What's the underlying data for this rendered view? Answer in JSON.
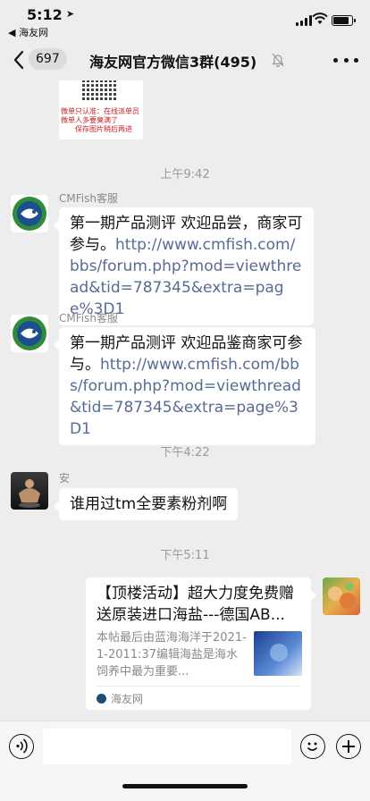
{
  "status_bar": {
    "time": "5:12",
    "back_app": "◀ 海友网",
    "battery_level": 0.9
  },
  "nav": {
    "unread_count": "697",
    "title": "海友网官方微信3群(495)"
  },
  "messages": {
    "image_caption_1": "微单只认准：在线派单员",
    "image_caption_2": "微单人多要臭满了",
    "image_caption_3": "保存图片稍后再进",
    "time_1": "上午9:42",
    "msg1": {
      "sender": "CMFish客服",
      "text": "第一期产品测评 欢迎品尝，商家可参与。",
      "link": "http://www.cmfish.com/bbs/forum.php?mod=viewthread&tid=787345&extra=page%3D1"
    },
    "msg2": {
      "sender": "CMFish客服",
      "text": "第一期产品测评 欢迎品鉴商家可参与。",
      "link": "http://www.cmfish.com/bbs/forum.php?mod=viewthread&tid=787345&extra=page%3D1"
    },
    "time_2": "下午4:22",
    "msg3": {
      "sender": "安",
      "text": "谁用过tm全要素粉剂啊"
    },
    "time_3": "下午5:11",
    "card": {
      "title": "【顶楼活动】超大力度免费赠送原装进口海盐---德国AB...",
      "description": "本帖最后由蓝海海洋于2021-1-2011:37编辑海盐是海水饲养中最为重要...",
      "source": "海友网"
    }
  },
  "colors": {
    "link": "#576b95",
    "background": "#ededed"
  }
}
